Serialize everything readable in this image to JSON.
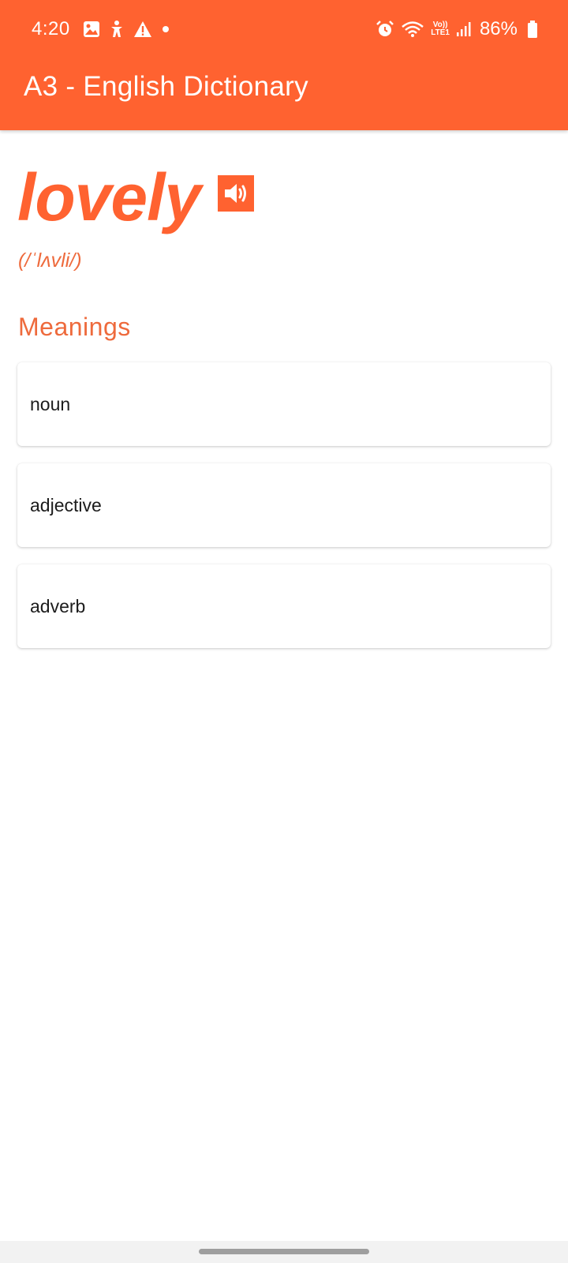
{
  "status_bar": {
    "time": "4:20",
    "left_icons": [
      "gallery-icon",
      "accessibility-icon",
      "warning-icon",
      "dot-icon"
    ],
    "right_icons": [
      "alarm-icon",
      "wifi-icon",
      "volte-icon",
      "signal-icon",
      "battery-icon"
    ],
    "volte_top": "Vo))",
    "volte_bottom": "LTE1",
    "battery": "86%"
  },
  "app_bar": {
    "title": "A3 - English Dictionary",
    "color": "#ff6230"
  },
  "entry": {
    "word": "lovely",
    "phonetic": "(/ˈlʌvli/)",
    "audio_icon": "speaker-icon"
  },
  "meanings": {
    "heading": "Meanings",
    "items": [
      {
        "label": "noun"
      },
      {
        "label": "adjective"
      },
      {
        "label": "adverb"
      }
    ]
  },
  "colors": {
    "accent": "#ff6230",
    "text": "#1c1c1c",
    "background": "#ffffff"
  }
}
